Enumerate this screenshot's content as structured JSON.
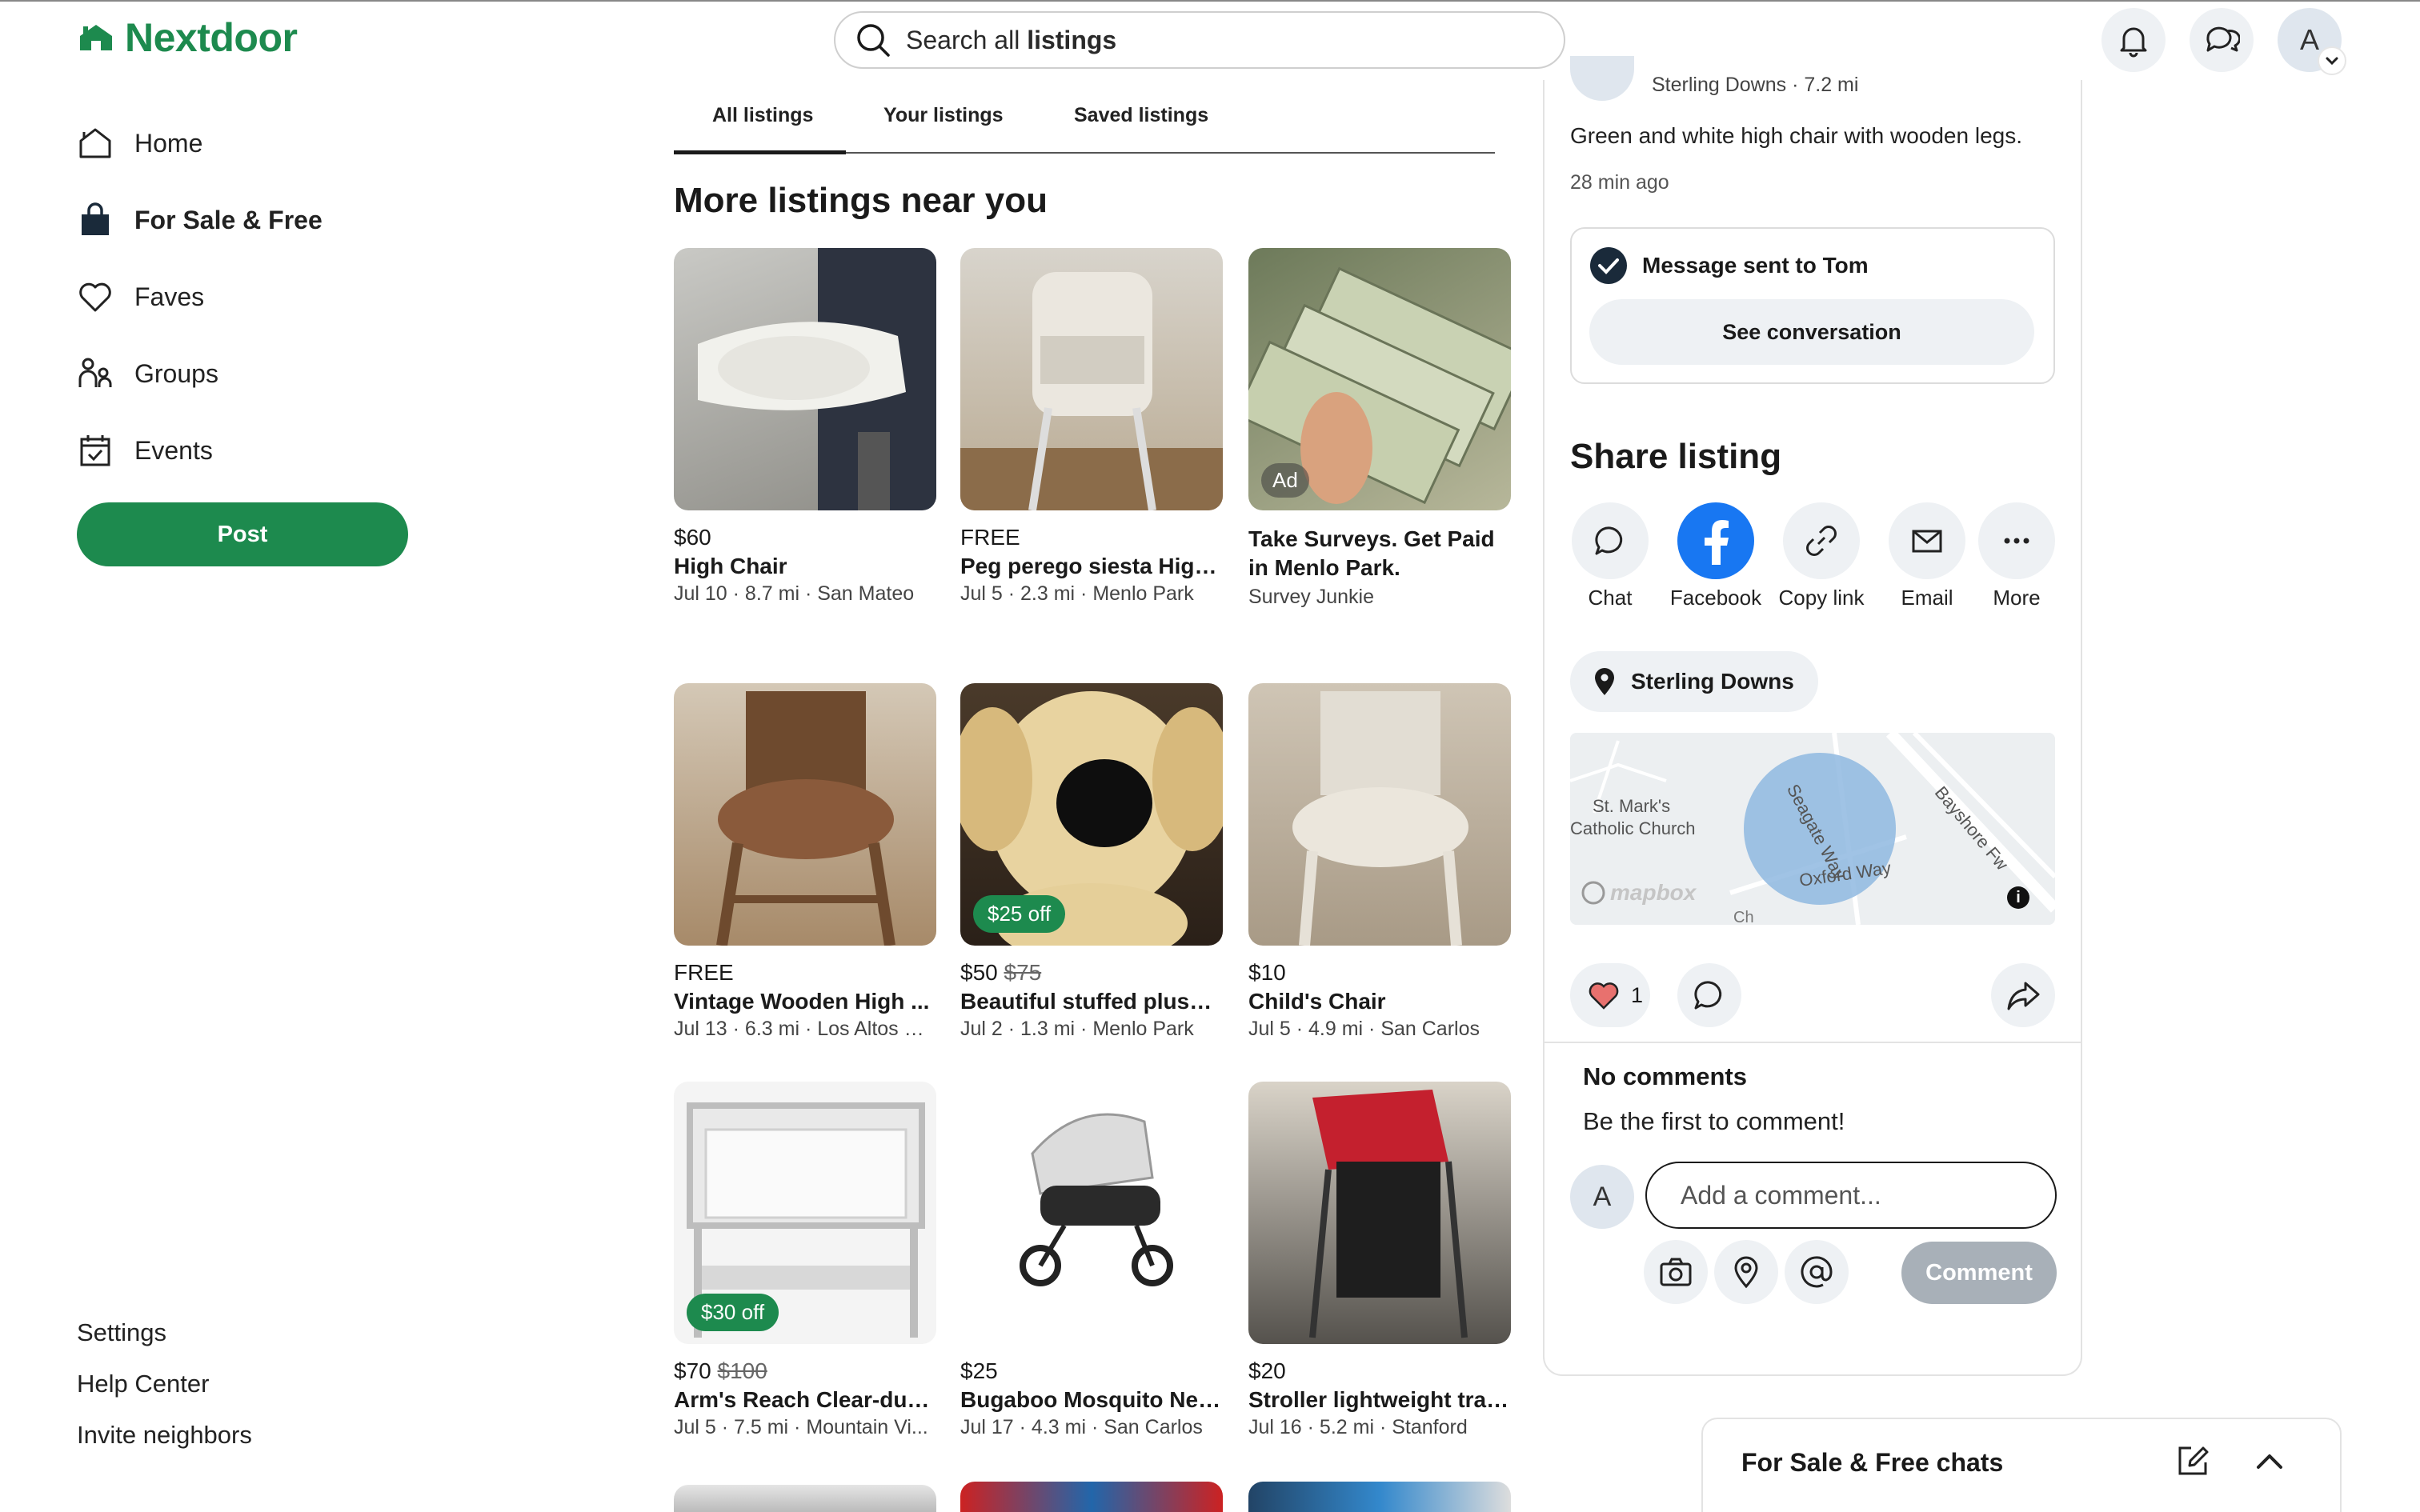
{
  "header": {
    "brand": "Nextdoor",
    "search_prefix": "Search all ",
    "search_bold": "listings",
    "avatar_initial": "A"
  },
  "sidebar": {
    "items": [
      {
        "label": "Home",
        "icon": "home-icon"
      },
      {
        "label": "For Sale & Free",
        "icon": "shopping-bag-icon",
        "active": true
      },
      {
        "label": "Faves",
        "icon": "heart-icon"
      },
      {
        "label": "Groups",
        "icon": "groups-icon"
      },
      {
        "label": "Events",
        "icon": "calendar-icon"
      }
    ],
    "post_label": "Post",
    "footer_links": [
      "Settings",
      "Help Center",
      "Invite neighbors"
    ]
  },
  "tabs": [
    "All listings",
    "Your listings",
    "Saved listings"
  ],
  "section_title": "More listings near you",
  "listings": [
    {
      "price": "$60",
      "title": "High Chair",
      "meta": "Jul 10 · 8.7 mi · San Mateo"
    },
    {
      "price": "FREE",
      "title": "Peg perego siesta High ...",
      "meta": "Jul 5 · 2.3 mi · Menlo Park"
    },
    {
      "price": "",
      "title": "Take Surveys. Get Paid in Menlo Park.",
      "meta": "Survey Junkie",
      "ad": "Ad"
    },
    {
      "price": "FREE",
      "title": "Vintage Wooden High ...",
      "meta": "Jul 13 · 6.3 mi · Los Altos Hi..."
    },
    {
      "price": "$50",
      "old_price": "$75",
      "title": "Beautiful stuffed plush ...",
      "meta": "Jul 2 · 1.3 mi · Menlo Park",
      "badge": "$25 off"
    },
    {
      "price": "$10",
      "title": "Child's Chair",
      "meta": "Jul 5 · 4.9 mi · San Carlos"
    },
    {
      "price": "$70",
      "old_price": "$100",
      "title": "Arm's Reach Clear-due ...",
      "meta": "Jul 5 · 7.5 mi · Mountain Vi...",
      "badge": "$30 off"
    },
    {
      "price": "$25",
      "title": "Bugaboo Mosquito Net ...",
      "meta": "Jul 17 · 4.3 mi · San Carlos"
    },
    {
      "price": "$20",
      "title": "Stroller lightweight travel",
      "meta": "Jul 16 · 5.2 mi · Stanford"
    }
  ],
  "detail": {
    "seller_meta": "Sterling Downs · 7.2 mi",
    "description": "Green and white high chair with wooden legs.",
    "posted": "28 min ago",
    "message_sent": "Message sent to Tom",
    "see_conversation": "See conversation",
    "share_title": "Share listing",
    "share_options": [
      {
        "label": "Chat",
        "icon": "chat-icon"
      },
      {
        "label": "Facebook",
        "icon": "facebook-icon"
      },
      {
        "label": "Copy link",
        "icon": "link-icon"
      },
      {
        "label": "Email",
        "icon": "email-icon"
      },
      {
        "label": "More",
        "icon": "more-icon"
      }
    ],
    "location": "Sterling Downs",
    "map_labels": {
      "church_1": "St. Mark's",
      "church_2": "Catholic Church",
      "road_1": "Seagate Way",
      "road_2": "Oxford Way",
      "road_3": "Bayshore Fw",
      "attribution": "mapbox",
      "road_4": "Ch"
    },
    "like_count": "1",
    "no_comments": "No comments",
    "be_first": "Be the first to comment!",
    "commenter_initial": "A",
    "comment_placeholder": "Add a comment...",
    "comment_button": "Comment"
  },
  "chats": {
    "title": "For Sale & Free chats"
  },
  "colors": {
    "brand_green": "#1d8a4e",
    "facebook_blue": "#1877f2",
    "map_circle": "#8fb8e0"
  }
}
